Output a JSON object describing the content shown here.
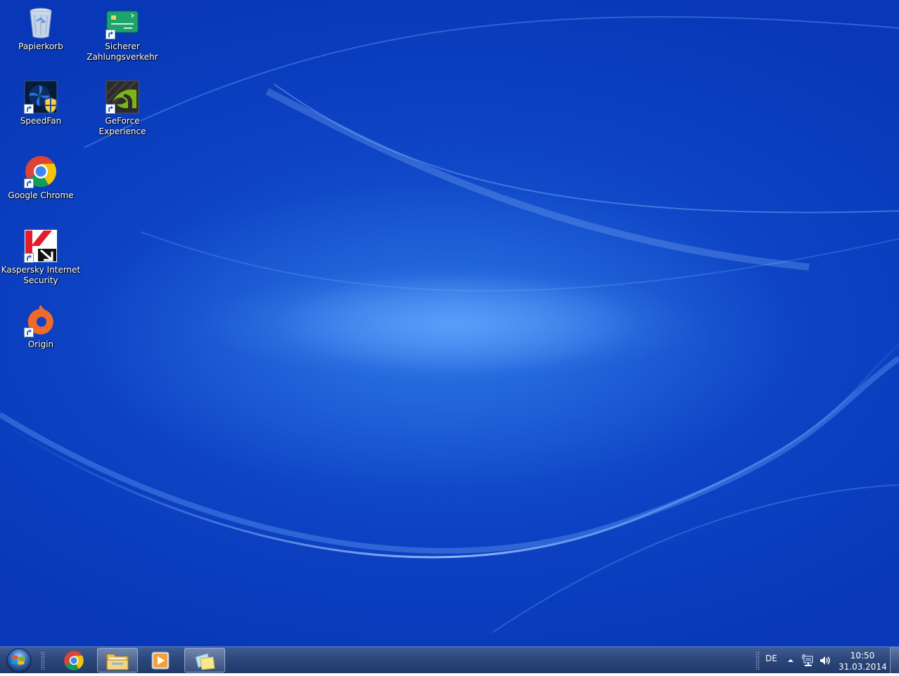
{
  "desktop": {
    "icons": [
      {
        "label": "Papierkorb",
        "icon": "recycle-bin-icon"
      },
      {
        "label": "Sicherer Zahlungsverkehr",
        "icon": "credit-card-icon"
      },
      {
        "label": "SpeedFan",
        "icon": "speedfan-icon"
      },
      {
        "label": "GeForce Experience",
        "icon": "geforce-experience-icon"
      },
      {
        "label": "Google Chrome",
        "icon": "chrome-icon"
      },
      {
        "label": "Kaspersky Internet Security",
        "icon": "kaspersky-icon"
      },
      {
        "label": "Origin",
        "icon": "origin-icon"
      }
    ]
  },
  "taskbar": {
    "start": {
      "icon": "windows-logo-icon"
    },
    "pinned": [
      {
        "name": "Google Chrome",
        "icon": "chrome-icon",
        "active": false
      },
      {
        "name": "Windows Explorer",
        "icon": "folder-icon",
        "active": true
      },
      {
        "name": "Windows Media Player",
        "icon": "media-player-icon",
        "active": false
      },
      {
        "name": "Sticky Notes",
        "icon": "sticky-notes-icon",
        "active": true
      }
    ],
    "tray": {
      "language": "DE",
      "time": "10:50",
      "date": "31.03.2014"
    }
  },
  "colors": {
    "wallpaper_base": "#0d43c4",
    "taskbar": "#2c477a"
  }
}
